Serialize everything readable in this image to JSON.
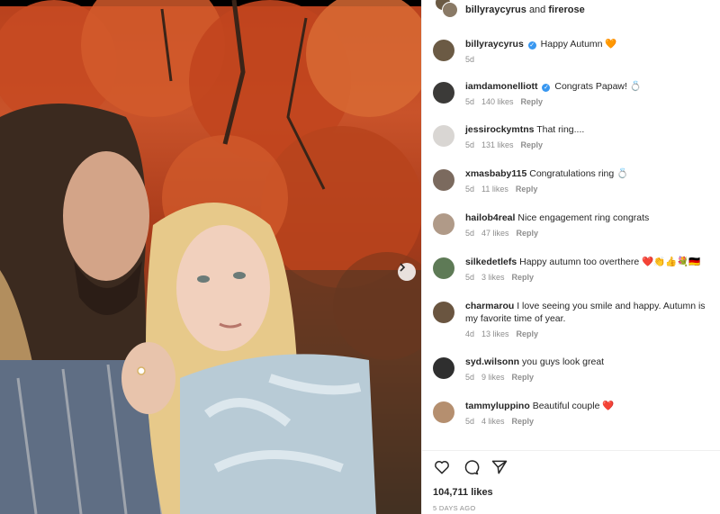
{
  "post": {
    "header_user1": "billyraycyrus",
    "header_and": "and",
    "header_user2": "firerose",
    "likes": "104,711 likes",
    "posted": "5 DAYS AGO"
  },
  "caption": {
    "user": "billyraycyrus",
    "text": "Happy Autumn 🧡",
    "age": "5d"
  },
  "comments": [
    {
      "user": "iamdamonelliott",
      "verified": true,
      "text": "Congrats Papaw! 💍",
      "age": "5d",
      "likes": "140 likes",
      "reply": "Reply",
      "avatar": "#3b3a38"
    },
    {
      "user": "jessirockymtns",
      "verified": false,
      "text": "That ring....",
      "age": "5d",
      "likes": "131 likes",
      "reply": "Reply",
      "avatar": "#d9d6d3"
    },
    {
      "user": "xmasbaby115",
      "verified": false,
      "text": "Congratulations ring 💍",
      "age": "5d",
      "likes": "11 likes",
      "reply": "Reply",
      "avatar": "#7b6a5e"
    },
    {
      "user": "hailob4real",
      "verified": false,
      "text": "Nice engagement ring congrats",
      "age": "5d",
      "likes": "47 likes",
      "reply": "Reply",
      "avatar": "#b09a88"
    },
    {
      "user": "silkedetlefs",
      "verified": false,
      "text": "Happy autumn too overthere ❤️👏👍💐🇩🇪",
      "age": "5d",
      "likes": "3 likes",
      "reply": "Reply",
      "avatar": "#5e7a56"
    },
    {
      "user": "charmarou",
      "verified": false,
      "text": "I love seeing you smile and happy. Autumn is my favorite time of year.",
      "age": "4d",
      "likes": "13 likes",
      "reply": "Reply",
      "avatar": "#6a5540"
    },
    {
      "user": "syd.wilsonn",
      "verified": false,
      "text": "you guys look great",
      "age": "5d",
      "likes": "9 likes",
      "reply": "Reply",
      "avatar": "#2f2f2f"
    },
    {
      "user": "tammyluppino",
      "verified": false,
      "text": "Beautiful couple ❤️",
      "age": "5d",
      "likes": "4 likes",
      "reply": "Reply",
      "avatar": "#b58f6f"
    }
  ],
  "icons": {
    "like": "heart-outline-icon",
    "comment": "comment-bubble-icon",
    "share": "paper-plane-icon",
    "next": "chevron-right-icon"
  }
}
